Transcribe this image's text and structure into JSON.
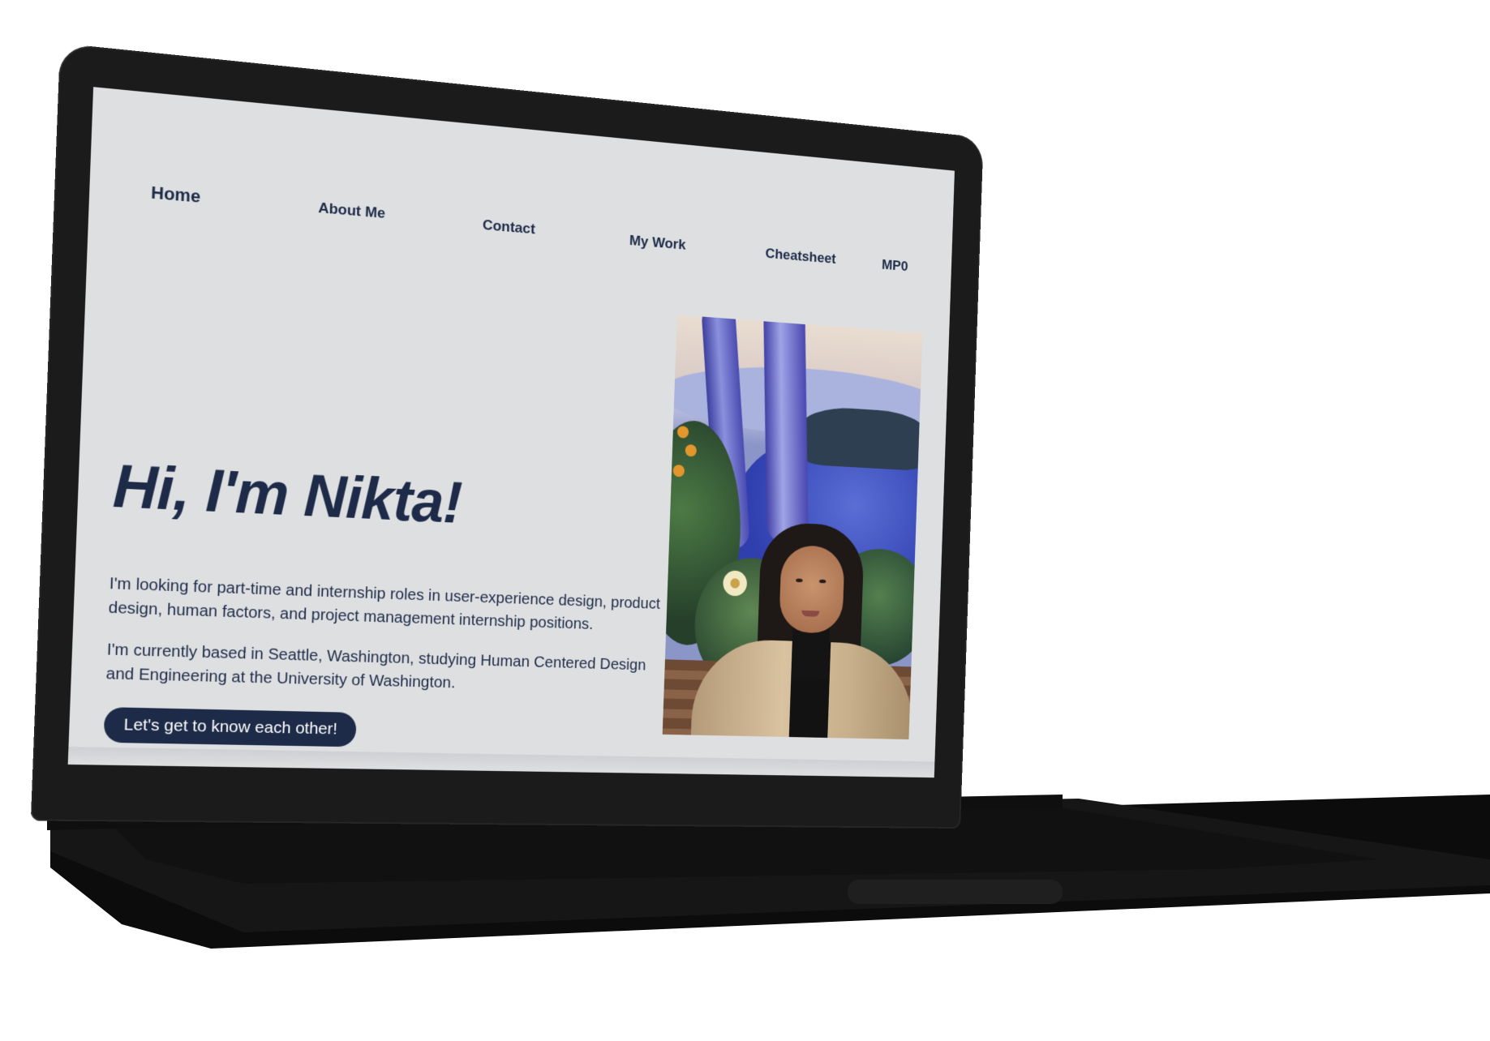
{
  "nav": {
    "items": [
      {
        "label": "Home",
        "active": true
      },
      {
        "label": "About Me",
        "active": false
      },
      {
        "label": "Contact",
        "active": false
      },
      {
        "label": "My Work",
        "active": false
      },
      {
        "label": "Cheatsheet",
        "active": false
      },
      {
        "label": "MP0",
        "active": false
      }
    ]
  },
  "hero": {
    "title": "Hi, I'm Nikta!",
    "paragraph_1": "I'm looking for part-time and internship roles in user-experience design, product design, human factors, and project management internship positions.",
    "paragraph_2": "I'm currently based in Seattle, Washington, studying Human Centered Design and Engineering at the University of Washington.",
    "cta_label": "Let's get to know each other!"
  },
  "colors": {
    "page_background": "#dedfe1",
    "text": "#1d2b48",
    "button_background": "#1d2b48",
    "button_text": "#ffffff",
    "device_body": "#1b1b1b"
  },
  "icons": {
    "portrait": "portrait-photo-with-mural"
  }
}
